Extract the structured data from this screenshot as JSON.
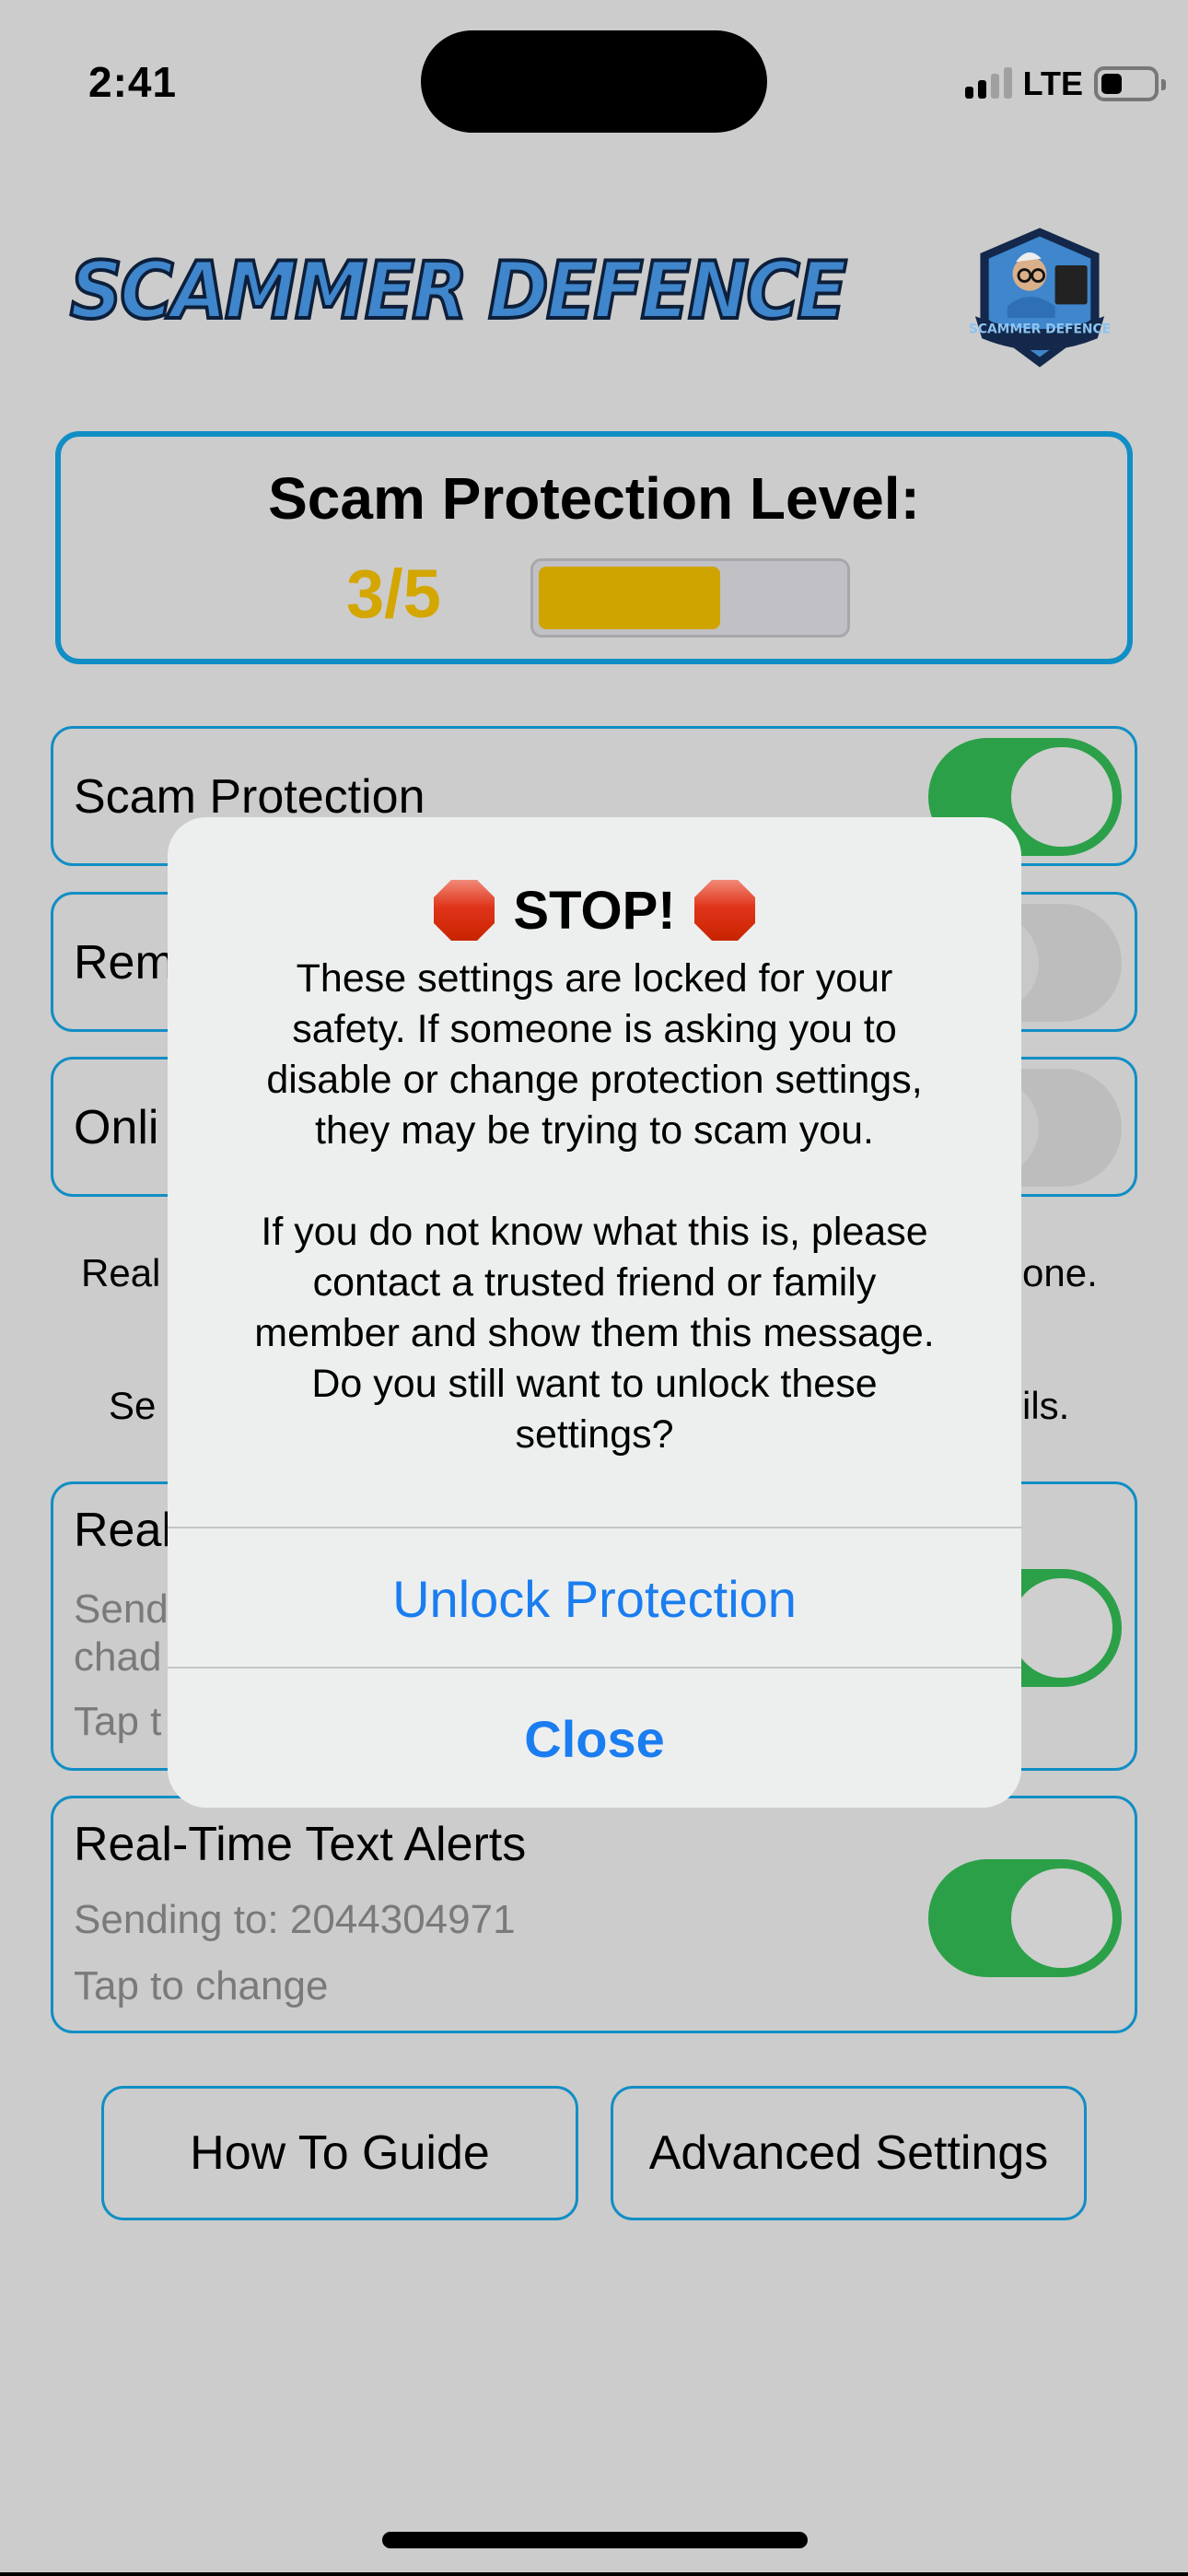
{
  "status_bar": {
    "time": "2:41",
    "network": "LTE",
    "signal_bars_active": 2,
    "signal_bars_total": 4,
    "battery_level": 0.25
  },
  "header": {
    "logo_text": "SCAMMER DEFENCE",
    "badge_text": "SCAMMER DEFENCE"
  },
  "protection_level": {
    "title": "Scam Protection Level:",
    "value_text": "3/5",
    "current": 3,
    "max": 5,
    "color": "#cfa400"
  },
  "settings": [
    {
      "label": "Scam Protection",
      "enabled": true
    },
    {
      "label": "Rem",
      "enabled": false
    },
    {
      "label": "Onli",
      "enabled": false
    }
  ],
  "info_lines": {
    "line1_left": "Real",
    "line1_right": "one.",
    "line2_left": "Se",
    "line2_right": "ils."
  },
  "email_alerts": {
    "title": "Real",
    "sending": "Send",
    "address": "chad",
    "tap": "Tap t",
    "enabled": true
  },
  "text_alerts": {
    "title": "Real-Time Text Alerts",
    "sending": "Sending to: 2044304971",
    "tap": "Tap to change",
    "enabled": true
  },
  "buttons": {
    "how_to": "How To Guide",
    "advanced": "Advanced Settings"
  },
  "alert": {
    "title": "STOP!",
    "icon": "stop-sign-icon",
    "message": "These settings are locked for your\nsafety. If someone is asking you to\ndisable or change protection settings,\nthey may be trying to scam you.\n\nIf you do not know what this is, please\ncontact a trusted friend or family\nmember and show them this message.\nDo you still want to unlock these\nsettings?",
    "primary": "Unlock Protection",
    "secondary": "Close",
    "accent": "#1a7df0"
  },
  "colors": {
    "background": "#cccccc",
    "border": "#118ec5",
    "toggle_on": "#2ba048"
  }
}
